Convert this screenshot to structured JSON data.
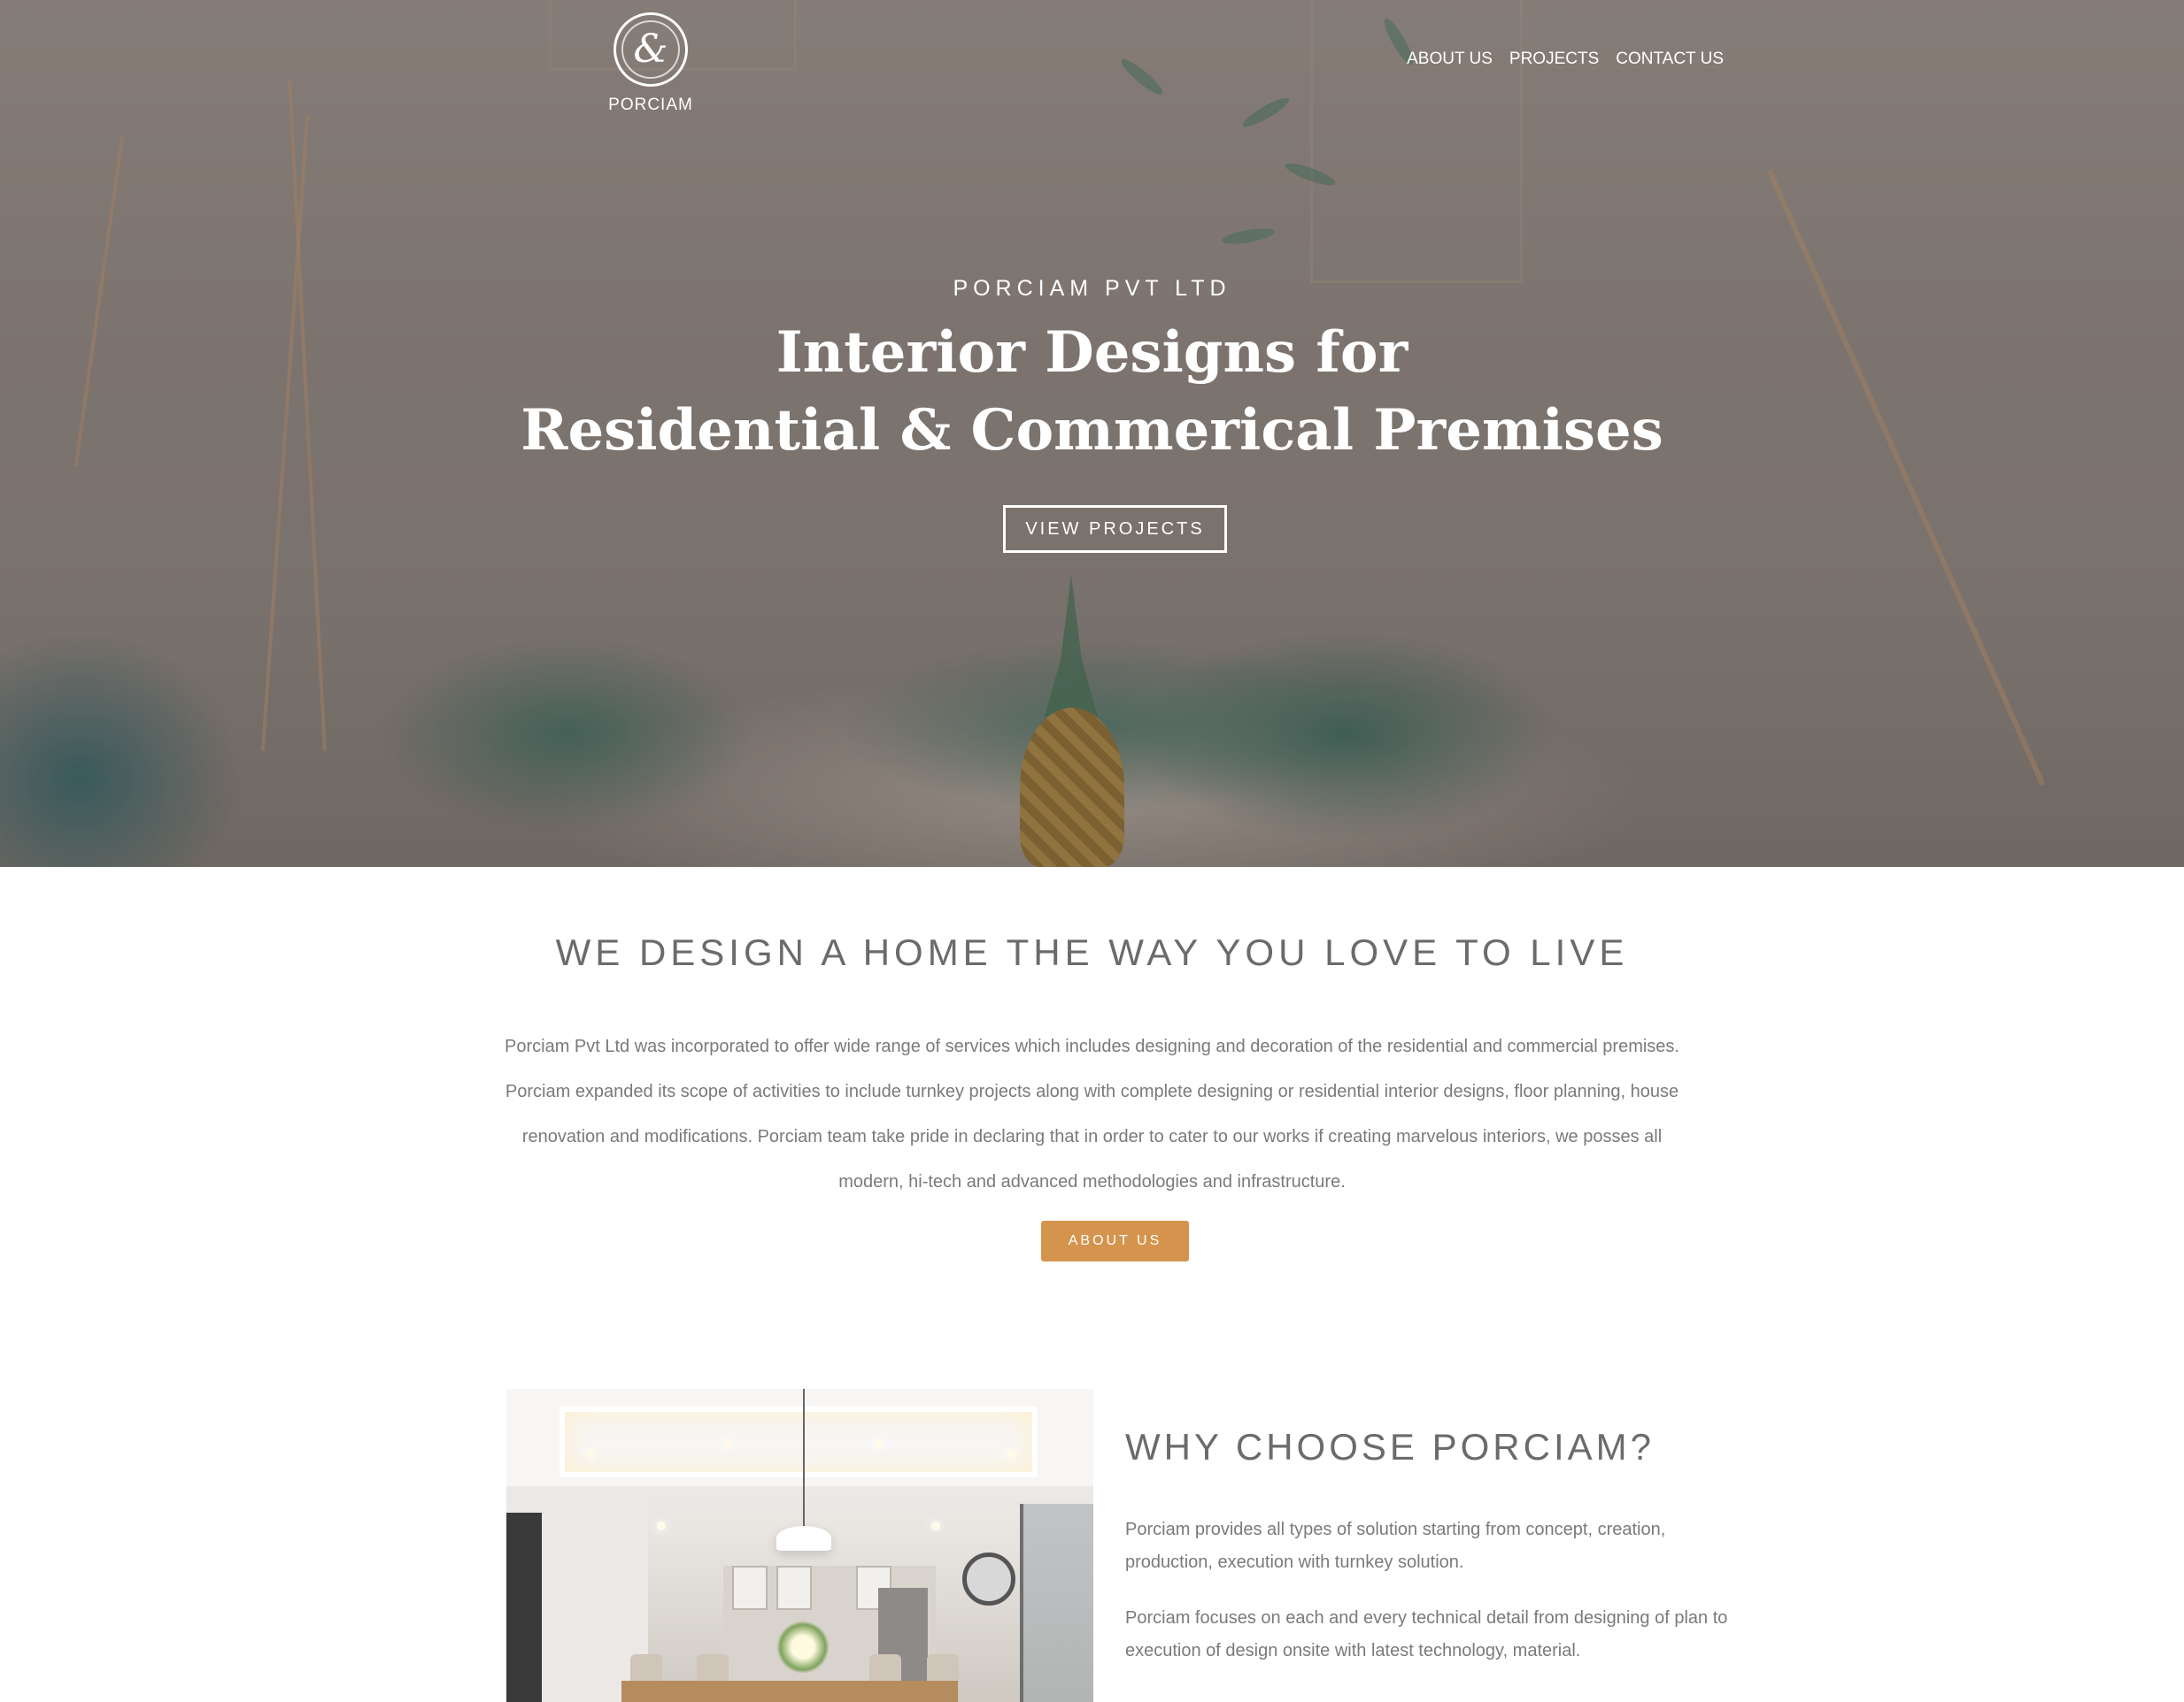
{
  "header": {
    "logo_text": "PORCIAM",
    "nav": [
      {
        "label": "ABOUT US"
      },
      {
        "label": "PROJECTS"
      },
      {
        "label": "CONTACT US"
      }
    ]
  },
  "hero": {
    "eyebrow": "PORCIAM PVT LTD",
    "title_line1": "Interior Designs for",
    "title_line2": "Residential & Commerical Premises",
    "button": "VIEW PROJECTS"
  },
  "intro": {
    "title": "WE DESIGN A HOME THE WAY YOU LOVE TO LIVE",
    "text": "Porciam Pvt Ltd was incorporated to offer wide range of services which includes designing and decoration of the residential and commercial premises. Porciam expanded its scope of activities to include turnkey projects along with complete designing or residential interior designs, floor planning, house renovation and modifications. Porciam team take pride in declaring that in order to cater to our works if creating marvelous interiors, we posses all modern, hi-tech and advanced methodologies and infrastructure.",
    "button": "ABOUT US"
  },
  "why": {
    "title": "WHY CHOOSE PORCIAM?",
    "paragraphs": [
      "Porciam provides all types of solution starting from concept, creation, production, execution with turnkey solution.",
      "Porciam focuses on each and every technical detail from designing of plan to execution of design onsite with latest technology, material."
    ]
  },
  "colors": {
    "accent": "#d4944e",
    "heading_gray": "#6b6b6b",
    "body_gray": "#7a7a7a"
  },
  "icons": {
    "logo": "porciam-logo-icon"
  }
}
